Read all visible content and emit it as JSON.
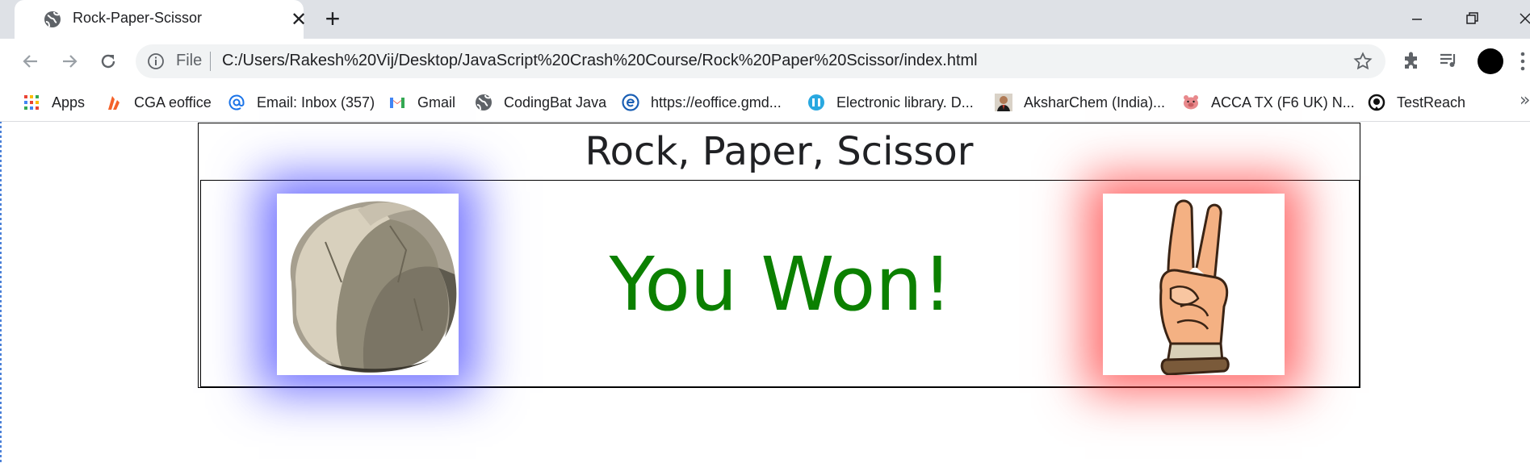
{
  "browser": {
    "tab": {
      "title": "Rock-Paper-Scissor",
      "close_glyph": "✕"
    },
    "new_tab_glyph": "+",
    "address": {
      "scheme_label": "File",
      "url": "C:/Users/Rakesh%20Vij/Desktop/JavaScript%20Crash%20Course/Rock%20Paper%20Scissor/index.html"
    },
    "bookmarks": [
      {
        "label": "Apps",
        "icon": "apps-grid-icon"
      },
      {
        "label": "CGA eoffice",
        "icon": "cga-logo-icon"
      },
      {
        "label": "Email: Inbox (357)",
        "icon": "at-sign-icon"
      },
      {
        "label": "Gmail",
        "icon": "gmail-icon"
      },
      {
        "label": "CodingBat Java",
        "icon": "globe-icon"
      },
      {
        "label": "https://eoffice.gmd...",
        "icon": "eoffice-icon"
      },
      {
        "label": "Electronic library. D...",
        "icon": "library-icon"
      },
      {
        "label": "AksharChem (India)...",
        "icon": "person-photo-icon"
      },
      {
        "label": "ACCA TX (F6 UK) N...",
        "icon": "pig-icon"
      },
      {
        "label": "TestReach",
        "icon": "testreach-icon"
      }
    ],
    "bookmarks_more_glyph": "»",
    "colors": {
      "chrome": "#dee1e6",
      "omnibox": "#f1f3f4"
    }
  },
  "game": {
    "title": "Rock, Paper, Scissor",
    "result": "You Won!",
    "user_choice": "rock",
    "bot_choice": "scissor",
    "colors": {
      "result": "#0b8000",
      "user_glow": "#4646ff",
      "bot_glow": "#ff3c3c"
    }
  }
}
